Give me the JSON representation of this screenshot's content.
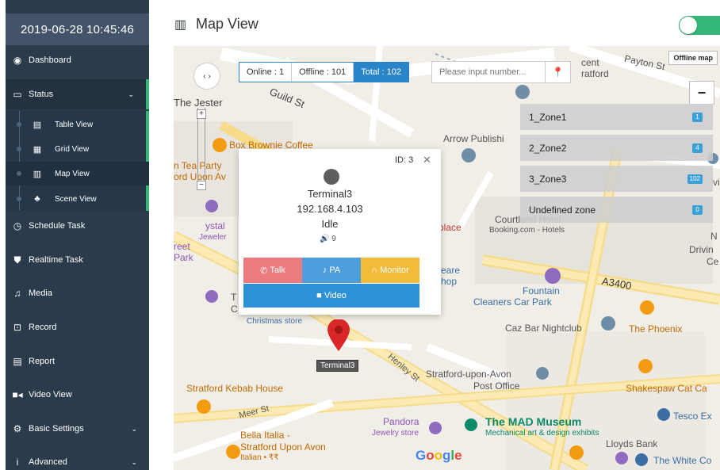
{
  "sidebar": {
    "datetime": "2019-06-28 10:45:46",
    "items": [
      {
        "label": "Dashboard",
        "icon": "dashboard-icon"
      },
      {
        "label": "Status",
        "icon": "monitor-icon",
        "expanded": true
      },
      {
        "label": "Schedule Task",
        "icon": "clock-icon"
      },
      {
        "label": "Realtime Task",
        "icon": "shield-icon"
      },
      {
        "label": "Media",
        "icon": "music-icon"
      },
      {
        "label": "Record",
        "icon": "voicemail-icon"
      },
      {
        "label": "Report",
        "icon": "report-icon"
      },
      {
        "label": "Video View",
        "icon": "video-icon"
      },
      {
        "label": "Basic Settings",
        "icon": "gear-icon"
      },
      {
        "label": "Advanced",
        "icon": "info-icon"
      }
    ],
    "status_sub": [
      {
        "label": "Table View",
        "icon": "table-icon"
      },
      {
        "label": "Grid View",
        "icon": "grid-icon"
      },
      {
        "label": "Map View",
        "icon": "map-icon",
        "active": true
      },
      {
        "label": "Scene View",
        "icon": "tree-icon"
      }
    ]
  },
  "header": {
    "title": "Map View",
    "toggle_on": true,
    "accent_color": "#34b676"
  },
  "map": {
    "stats": {
      "online": "Online : 1",
      "offline": "Offline : 101",
      "total": "Total : 102"
    },
    "search_placeholder": "Please input number...",
    "offline_map_label": "Offline map",
    "zoom_out_label": "−",
    "zones": [
      {
        "name": "1_Zone1",
        "count": "1"
      },
      {
        "name": "2_Zone2",
        "count": "4"
      },
      {
        "name": "3_Zone3",
        "count": "102"
      },
      {
        "name": "Undefined zone",
        "count": "0"
      }
    ],
    "popup": {
      "id": "ID: 3",
      "name": "Terminal3",
      "ip": "192.168.4.103",
      "state": "Idle",
      "volume": "9",
      "actions": {
        "talk": "Talk",
        "pa": "PA",
        "monitor": "Monitor",
        "video": "Video"
      }
    },
    "marker_label": "Terminal3",
    "places": {
      "payton": "Payton St",
      "guild": "Guild St",
      "jester": "The Jester",
      "box": "Box Brownie Coffee",
      "tea1": "n Tea Party",
      "tea2": "ord Upon Av",
      "arrow": "Arrow Publishi",
      "courtland1": "Courtland Hotel",
      "courtland2": "Booking.com - Hotels",
      "crystal": "ystal",
      "jeweler": "Jeweler",
      "reet": "reet",
      "park": "Park",
      "place": "place",
      "eare": "eare",
      "hop": "hop",
      "fountain1": "Fountain",
      "fountain2": "Cleaners Car Park",
      "a3400": "A3400",
      "xmas": "Christmas store",
      "caz": "Caz Bar Nightclub",
      "phoenix": "The Phoenix",
      "henley": "Henley St",
      "kebab": "Stratford Kebab House",
      "postoffice1": "Stratford-upon-Avon",
      "postoffice2": "Post Office",
      "shakes": "Shakespaw Cat Ca",
      "meer": "Meer St",
      "pandora": "Pandora",
      "jewelry": "Jewelry store",
      "mad1": "The MAD Museum",
      "mad2": "Mechanical art & design exhibits",
      "tesco": "Tesco Ex",
      "bella1": "Bella Italia -",
      "bella2": "Stratford Upon Avon",
      "bella3": "Italian • ₹₹",
      "lloyds": "Lloyds Bank",
      "white": "The White Co",
      "cent": "cent",
      "ratford": "ratford",
      "driving": "Drivin",
      "ce": "Ce",
      "n": "N",
      "vi": "vi",
      "t": "T",
      "c": "C",
      "google": "Google"
    }
  }
}
